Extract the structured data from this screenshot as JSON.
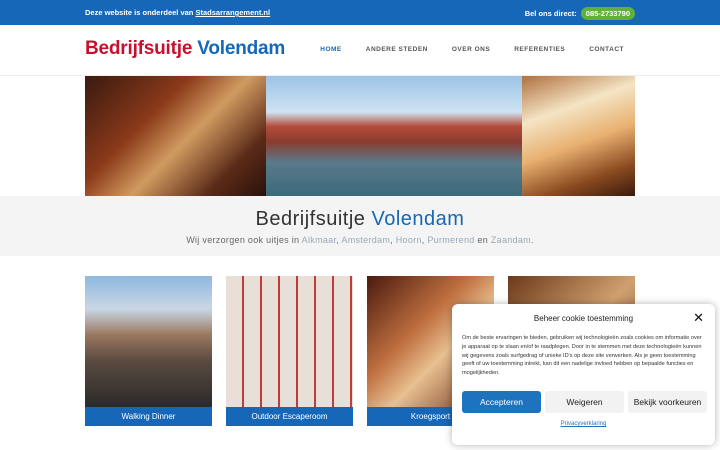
{
  "topbar": {
    "notice_prefix": "Deze website is onderdeel van",
    "notice_link": "Stadsarrangement.nl",
    "call_label": "Bel ons direct:",
    "phone": "085-2733790"
  },
  "header": {
    "logo_part1": "Bedrijfsuitje",
    "logo_part2": "Volendam",
    "nav": [
      "HOME",
      "ANDERE STEDEN",
      "OVER ONS",
      "REFERENTIES",
      "CONTACT"
    ],
    "active_nav": "HOME"
  },
  "intro": {
    "title_part1": "Bedrijfsuitje",
    "title_part2": "Volendam",
    "sub_prefix": "Wij verzorgen ook uitjes in",
    "cities": [
      "Alkmaar",
      "Amsterdam",
      "Hoorn",
      "Purmerend"
    ],
    "sub_and": "en",
    "last_city": "Zaandam",
    "sub_suffix": "."
  },
  "cards": [
    {
      "label": "Walking Dinner"
    },
    {
      "label": "Outdoor Escaperoom"
    },
    {
      "label": "Kroegsport"
    },
    {
      "label": ""
    }
  ],
  "cookie": {
    "title": "Beheer cookie toestemming",
    "body": "Om de beste ervaringen te bieden, gebruiken wij technologieën zoals cookies om informatie over je apparaat op te slaan en/of te raadplegen. Door in te stemmen met deze technologieën kunnen wij gegevens zoals surfgedrag of unieke ID's op deze site verwerken. Als je geen toestemming geeft of uw toestemming intrekt, kan dit een nadelige invloed hebben op bepaalde functies en mogelijkheden.",
    "accept": "Accepteren",
    "deny": "Weigeren",
    "prefs": "Bekijk voorkeuren",
    "policy": "Privacyverklaring",
    "close_icon": "close-icon"
  },
  "colors": {
    "brand_blue": "#1667b8",
    "brand_red": "#c8102e",
    "phone_green": "#5fb13c"
  }
}
